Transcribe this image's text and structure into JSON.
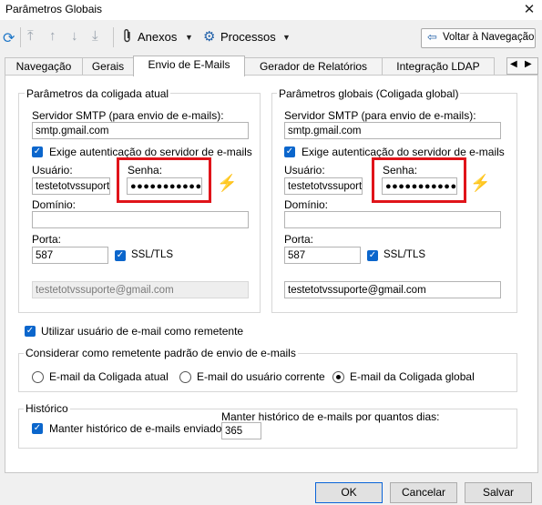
{
  "window": {
    "title": "Parâmetros Globais",
    "close": "✕"
  },
  "toolbar": {
    "annex_label": "Anexos",
    "process_label": "Processos",
    "back_label": "Voltar à Navegação"
  },
  "tabs": [
    {
      "label": "Navegação"
    },
    {
      "label": "Gerais"
    },
    {
      "label": "Envio de E-Mails"
    },
    {
      "label": "Gerador de Relatórios"
    },
    {
      "label": "Integração LDAP"
    }
  ],
  "left_group": {
    "title": "Parâmetros da coligada atual",
    "smtp_label": "Servidor SMTP (para envio de e-mails):",
    "smtp_value": "smtp.gmail.com",
    "auth_label": "Exige autenticação do servidor de e-mails",
    "user_label": "Usuário:",
    "user_value": "testetotvssuporte",
    "password_label": "Senha:",
    "password_value": "●●●●●●●●●●●",
    "domain_label": "Domínio:",
    "domain_value": "",
    "port_label": "Porta:",
    "port_value": "587",
    "ssl_label": "SSL/TLS",
    "email_value": "testetotvssuporte@gmail.com"
  },
  "right_group": {
    "title": "Parâmetros globais (Coligada global)",
    "smtp_label": "Servidor SMTP (para envio de e-mails):",
    "smtp_value": "smtp.gmail.com",
    "auth_label": "Exige autenticação do servidor de e-mails",
    "user_label": "Usuário:",
    "user_value": "testetotvssuporte",
    "password_label": "Senha:",
    "password_value": "●●●●●●●●●●●",
    "domain_label": "Domínio:",
    "domain_value": "",
    "port_label": "Porta:",
    "port_value": "587",
    "ssl_label": "SSL/TLS",
    "email_value": "testetotvssuporte@gmail.com"
  },
  "use_user_email_label": "Utilizar usuário de e-mail como remetente",
  "sender_group": {
    "title": "Considerar como remetente padrão de envio de e-mails",
    "options": [
      {
        "label": "E-mail da Coligada atual",
        "selected": false
      },
      {
        "label": "E-mail do usuário corrente",
        "selected": false
      },
      {
        "label": "E-mail da Coligada global",
        "selected": true
      }
    ]
  },
  "history_group": {
    "title": "Histórico",
    "keep_label": "Manter histórico de e-mails enviados",
    "days_label": "Manter histórico de e-mails por quantos dias:",
    "days_value": "365"
  },
  "buttons": {
    "ok": "OK",
    "cancel": "Cancelar",
    "save": "Salvar"
  },
  "colors": {
    "highlight": "#e0141a",
    "accent": "#0b66cc",
    "bolt": "#f4a400"
  },
  "icons": [
    "refresh-icon",
    "first-icon",
    "prev-icon",
    "next-icon",
    "last-icon",
    "paperclip-icon",
    "gear-icon",
    "back-arrow-icon",
    "lightning-icon"
  ]
}
